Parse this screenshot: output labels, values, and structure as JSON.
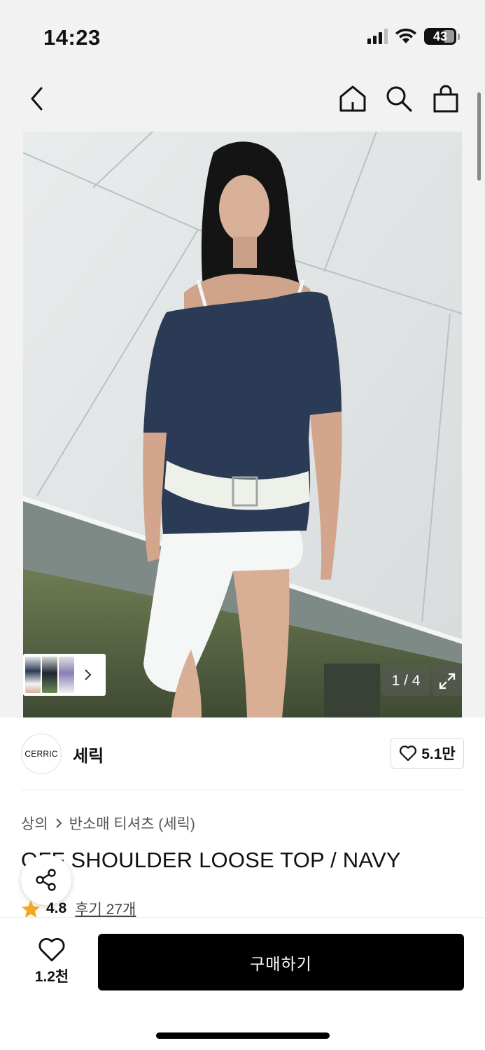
{
  "status_bar": {
    "time": "14:23",
    "battery": "43",
    "icons": [
      "signal-icon",
      "wifi-icon",
      "battery-icon"
    ]
  },
  "nav": {
    "icons": [
      "back-icon",
      "home-icon",
      "search-icon",
      "shopping-bag-icon"
    ]
  },
  "gallery": {
    "counter": "1 / 4",
    "current_index": 1,
    "total": 4,
    "icons": [
      "chevron-right-icon",
      "expand-icon"
    ]
  },
  "brand": {
    "logo_text": "CERRIC",
    "name": "세릭",
    "likes": "5.1만"
  },
  "breadcrumb": {
    "category": "상의",
    "subcategory": "반소매 티셔츠 (세릭)"
  },
  "product": {
    "title": "OFF SHOULDER LOOSE TOP / NAVY",
    "rating": "4.8",
    "reviews": "후기 27개"
  },
  "bottom_bar": {
    "wish_count": "1.2천",
    "buy_label": "구매하기"
  },
  "colors": {
    "background": "#f2f2f2",
    "buy_button": "#000000",
    "star": "#f5a623",
    "top_navy": "#2b3a55"
  }
}
